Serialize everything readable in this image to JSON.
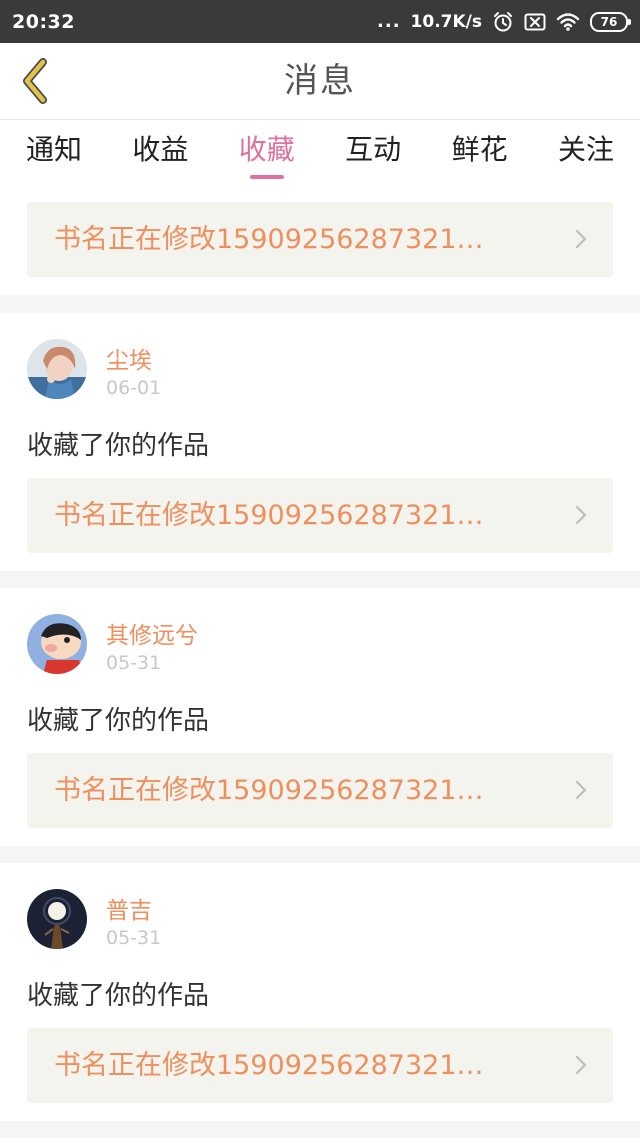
{
  "status_bar": {
    "time": "20:32",
    "dots": "...",
    "network_speed": "10.7K/s",
    "battery": "76",
    "icons": [
      "alarm-icon",
      "no-sim-icon",
      "wifi-icon",
      "battery-icon"
    ]
  },
  "header": {
    "title": "消息",
    "back_icon": "chevron-left-icon"
  },
  "tabs": [
    {
      "label": "通知"
    },
    {
      "label": "收益"
    },
    {
      "label": "收藏"
    },
    {
      "label": "互动"
    },
    {
      "label": "鲜花"
    },
    {
      "label": "关注"
    }
  ],
  "active_tab": "收藏",
  "top_card": {
    "work_title": "书名正在修改15909256287321…"
  },
  "messages": [
    {
      "username": "尘埃",
      "date": "06-01",
      "action": "收藏了你的作品",
      "work_title": "书名正在修改15909256287321…"
    },
    {
      "username": "其修远兮",
      "date": "05-31",
      "action": "收藏了你的作品",
      "work_title": "书名正在修改15909256287321…"
    },
    {
      "username": "普吉",
      "date": "05-31",
      "action": "收藏了你的作品",
      "work_title": "书名正在修改15909256287321…"
    }
  ],
  "colors": {
    "accent": "#e0719f",
    "orange_text": "#ef8f5e",
    "back_icon": "#e2c24a",
    "card_bg": "#f4f4ef"
  }
}
